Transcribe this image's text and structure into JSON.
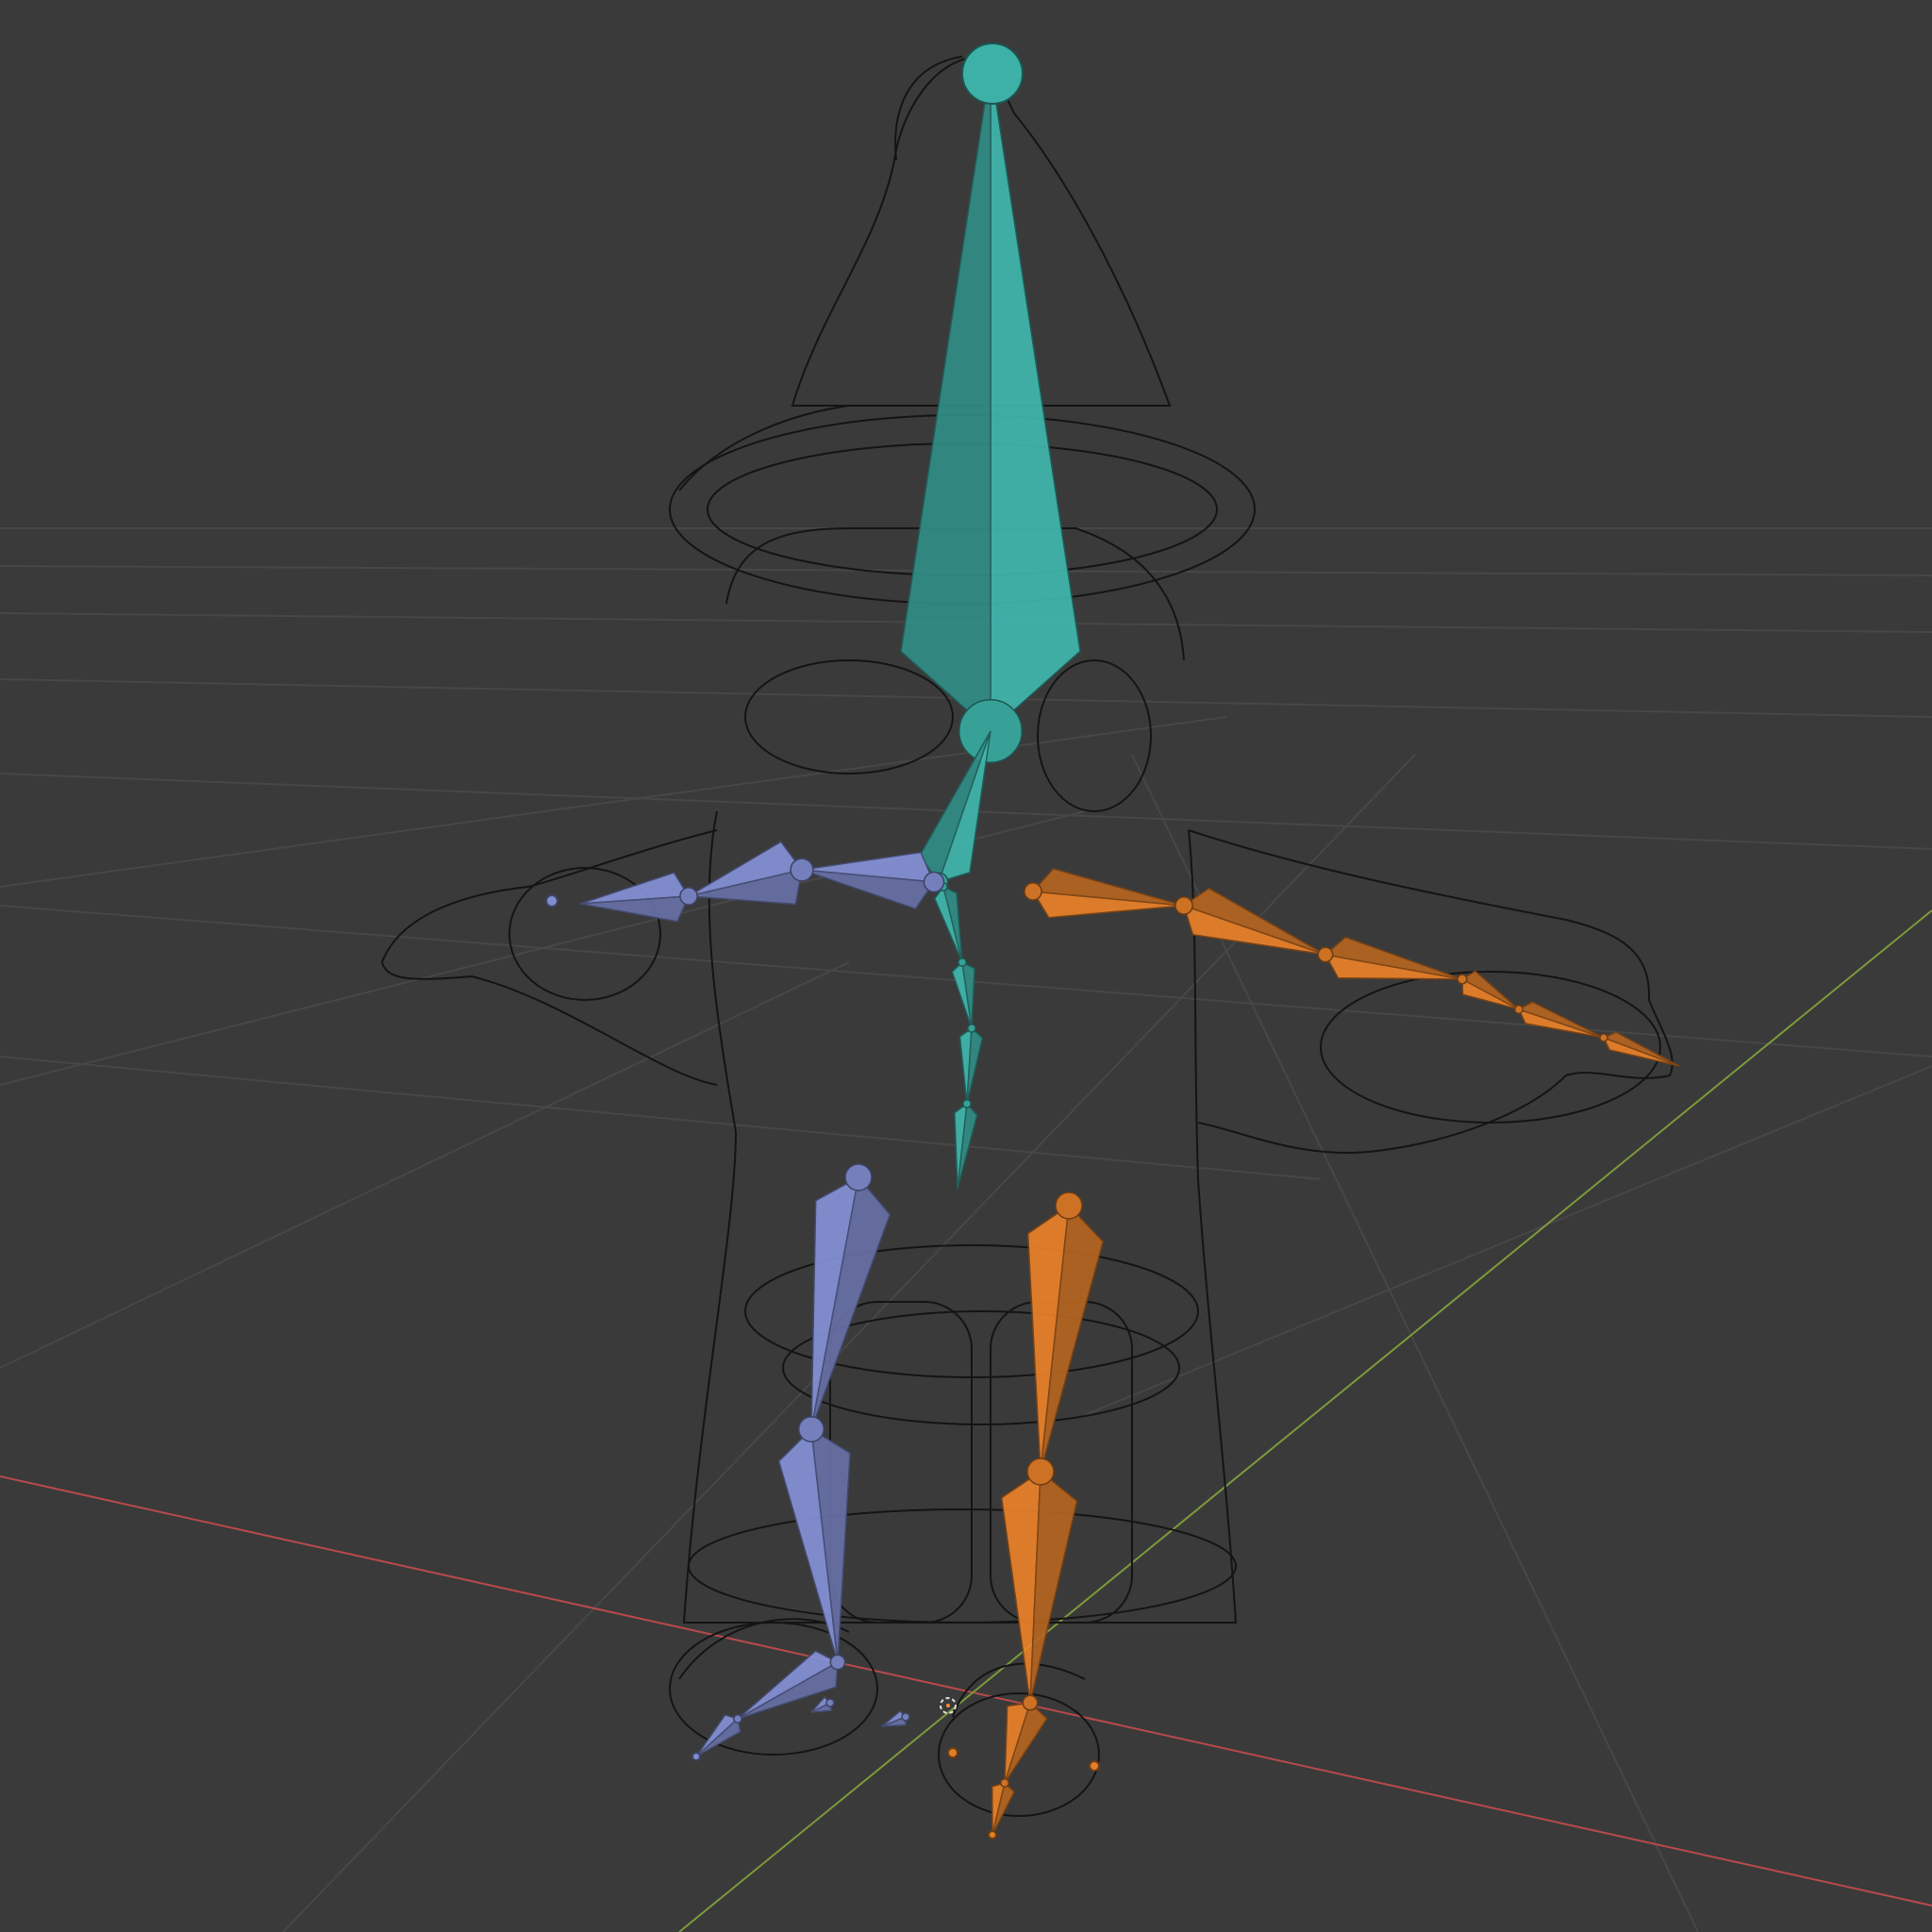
{
  "viewport": {
    "background": "#3a3a3a",
    "grid_color": "#474747",
    "axis_x_color": "#b84a4a",
    "axis_y_color": "#7c9a3a",
    "mesh_color": "#141414",
    "mode": "wireframe"
  },
  "armature": {
    "colors": {
      "spine": "#3aa9a0",
      "left": "#7a86c6",
      "right": "#d87826"
    },
    "bone_groups": [
      "spine",
      "left",
      "right"
    ]
  }
}
